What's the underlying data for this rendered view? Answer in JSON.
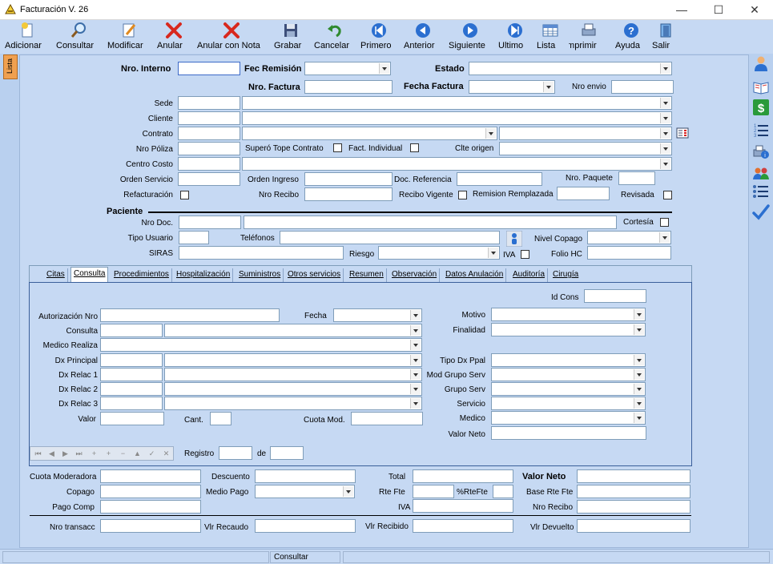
{
  "window": {
    "title": "Facturación V. 26",
    "minimize": "—",
    "maximize": "☐",
    "close": "✕"
  },
  "toolbar": [
    {
      "label": "Adicionar",
      "icon": "new-doc-icon"
    },
    {
      "label": "Consultar",
      "icon": "magnifier-icon"
    },
    {
      "label": "Modificar",
      "icon": "pencil-doc-icon"
    },
    {
      "label": "Anular",
      "icon": "red-x-icon"
    },
    {
      "label": "Anular con Nota",
      "icon": "red-x-icon"
    },
    {
      "label": "Grabar",
      "icon": "floppy-icon"
    },
    {
      "label": "Cancelar",
      "icon": "undo-arrow-icon"
    },
    {
      "label": "Primero",
      "icon": "first-record-icon"
    },
    {
      "label": "Anterior",
      "icon": "previous-record-icon"
    },
    {
      "label": "Siguiente",
      "icon": "next-record-icon"
    },
    {
      "label": "Ultimo",
      "icon": "last-record-icon"
    },
    {
      "label": "Lista",
      "icon": "grid-list-icon"
    },
    {
      "label": "Imprimir",
      "icon": "printer-icon"
    },
    {
      "label": "Ayuda",
      "icon": "help-icon"
    },
    {
      "label": "Salir",
      "icon": "exit-door-icon"
    }
  ],
  "side_tab": "Lista",
  "header": {
    "nro_interno": "Nro. Interno",
    "fec_remision": "Fec Remisión",
    "estado": "Estado",
    "nro_factura": "Nro. Factura",
    "fecha_factura": "Fecha Factura",
    "nro_envio": "Nro envio",
    "sede": "Sede",
    "cliente": "Cliente",
    "contrato": "Contrato",
    "nro_poliza": "Nro Póliza",
    "supero_tope": "Superó Tope Contrato",
    "fact_individual": "Fact. Individual",
    "clte_origen": "Clte origen",
    "centro_costo": "Centro Costo",
    "orden_servicio": "Orden Servicio",
    "orden_ingreso": "Orden Ingreso",
    "doc_referencia": "Doc. Referencia",
    "nro_paquete": "Nro. Paquete",
    "refacturacion": "Refacturación",
    "nro_recibo": "Nro Recibo",
    "recibo_vigente": "Recibo Vigente",
    "remision_remplazada": "Remision Remplazada",
    "revisada": "Revisada"
  },
  "paciente": {
    "section": "Paciente",
    "nro_doc": "Nro Doc.",
    "cortesia": "Cortesía",
    "tipo_usuario": "Tipo Usuario",
    "telefonos": "Teléfonos",
    "nivel_copago": "Nivel Copago",
    "siras": "SIRAS",
    "riesgo": "Riesgo",
    "iva": "IVA",
    "folio_hc": "Folio HC"
  },
  "tabs": [
    "Citas",
    "Consulta",
    "Procedimientos",
    "Hospitalización",
    "Suministros",
    "Otros servicios",
    "Resumen",
    "Observación",
    "Datos Anulación",
    "Auditoría",
    "Cirugía"
  ],
  "consulta": {
    "id_cons": "Id Cons",
    "autorizacion": "Autorización Nro",
    "fecha": "Fecha",
    "motivo": "Motivo",
    "consulta": "Consulta",
    "finalidad": "Finalidad",
    "medico_realiza": "Medico Realiza",
    "dx_principal": "Dx Principal",
    "tipo_dx_ppal": "Tipo Dx Ppal",
    "dx_relac_1": "Dx Relac 1",
    "mod_grupo_serv": "Mod Grupo Serv",
    "dx_relac_2": "Dx Relac 2",
    "grupo_serv": "Grupo Serv",
    "dx_relac_3": "Dx Relac 3",
    "servicio": "Servicio",
    "valor": "Valor",
    "cant": "Cant.",
    "cuota_mod": "Cuota Mod.",
    "medico": "Medico",
    "valor_neto": "Valor Neto",
    "registro": "Registro",
    "de": "de"
  },
  "navbar": [
    "⏮",
    "◀",
    "▶",
    "⏭",
    "+",
    "+",
    "−",
    "▲",
    "✓",
    "✕"
  ],
  "totals": {
    "cuota_moderadora": "Cuota Moderadora",
    "descuento": "Descuento",
    "total": "Total",
    "valor_neto": "Valor Neto",
    "copago": "Copago",
    "medio_pago": "Medio Pago",
    "rte_fte": "Rte Fte",
    "pct_rte_fte": "%RteFte",
    "base_rte_fte": "Base Rte Fte",
    "pago_comp": "Pago Comp",
    "iva": "IVA",
    "nro_recibo": "Nro Recibo",
    "nro_transacc": "Nro transacc",
    "vlr_recaudo": "Vlr Recaudo",
    "vlr_recibido": "Vlr Recibido",
    "vlr_devuelto": "Vlr Devuelto"
  },
  "status": {
    "mode": "Consultar"
  },
  "rightbar": [
    "user-icon",
    "book-icon",
    "dollar-icon",
    "numbered-list-icon",
    "print-info-icon",
    "group-icon",
    "bullet-list-icon",
    "check-icon"
  ]
}
